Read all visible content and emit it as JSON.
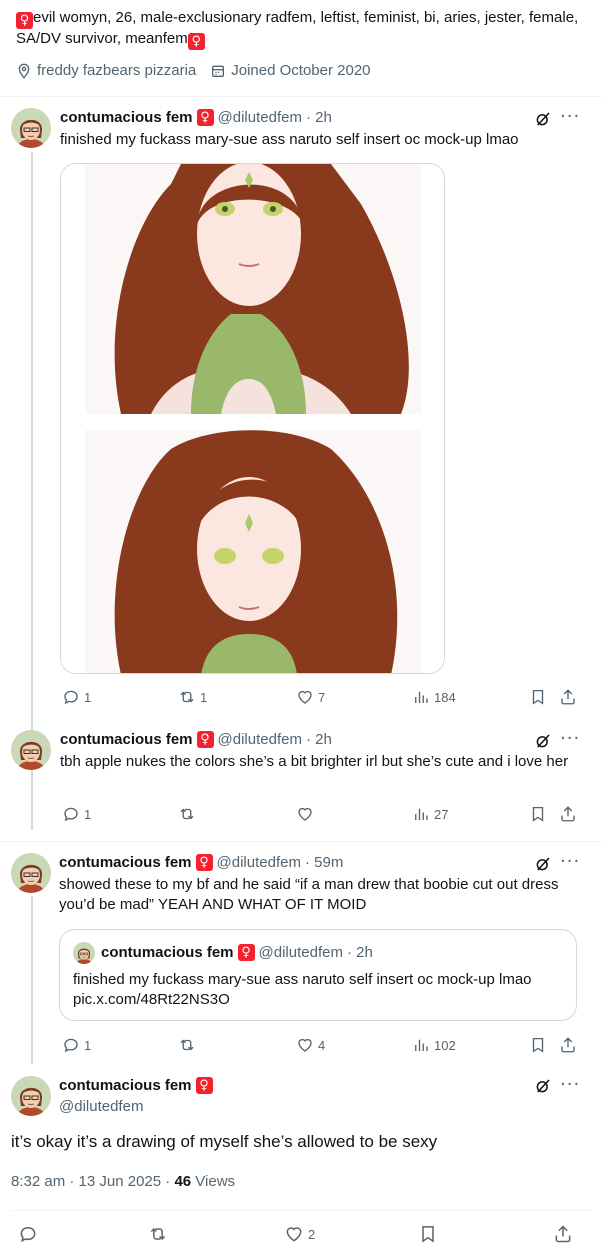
{
  "profile": {
    "bio_symbol": "♀",
    "bio_text": "evil womyn, 26, male-exclusionary radfem, leftist, feminist, bi, aries, jester, female, SA/DV survivor, meanfem",
    "bio_symbol_end": "♀",
    "location": "freddy fazbears pizzaria",
    "joined": "Joined October 2020"
  },
  "user": {
    "display_name": "contumacious fem",
    "name_badge": "♀",
    "handle": "@dilutedfem"
  },
  "tweets": [
    {
      "time": "· 2h",
      "text": "finished my fuckass mary-sue ass naruto self insert oc mock-up lmao",
      "replies": "1",
      "reposts": "1",
      "likes": "7",
      "views": "184"
    },
    {
      "time": "· 2h",
      "text": "tbh apple nukes the colors she’s a bit brighter irl but she’s cute and i love her",
      "replies": "1",
      "reposts": "",
      "likes": "",
      "views": "27"
    },
    {
      "time": "· 59m",
      "text": "showed these to my bf and he said “if a man drew that boobie cut out dress you’d be mad” YEAH AND WHAT OF IT MOID",
      "replies": "1",
      "reposts": "",
      "likes": "4",
      "views": "102",
      "quote": {
        "time": "· 2h",
        "text": "finished my fuckass mary-sue ass naruto self insert oc mock-up lmao",
        "link": "pic.x.com/48Rt22NS3O"
      }
    }
  ],
  "main": {
    "text": "it’s okay it’s a drawing of myself she’s allowed to be sexy",
    "time_date": "8:32 am · 13 Jun 2025 · ",
    "views_count": "46",
    "views_label": " Views",
    "likes": "2"
  },
  "colors": {
    "accent_badge": "#f4212e",
    "secondary_text": "#536471",
    "divider": "#eff3f4",
    "hair": "#8a3a1c",
    "dress": "#9ab86a"
  }
}
